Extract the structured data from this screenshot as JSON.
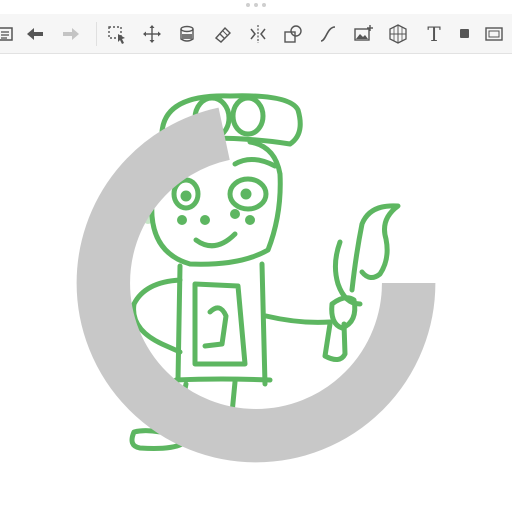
{
  "toolbar": {
    "tools": [
      {
        "id": "layers",
        "icon": "layers-list-icon"
      },
      {
        "id": "undo",
        "icon": "undo-arrow-icon"
      },
      {
        "id": "redo",
        "icon": "redo-arrow-icon"
      },
      {
        "id": "select",
        "icon": "selection-cursor-icon"
      },
      {
        "id": "move",
        "icon": "move-arrows-icon"
      },
      {
        "id": "fill",
        "icon": "paint-bucket-icon"
      },
      {
        "id": "eraser",
        "icon": "eraser-icon"
      },
      {
        "id": "symmetry",
        "icon": "symmetry-icon"
      },
      {
        "id": "shapes",
        "icon": "shapes-icon"
      },
      {
        "id": "curve",
        "icon": "curve-icon"
      },
      {
        "id": "image",
        "icon": "add-image-icon"
      },
      {
        "id": "perspective",
        "icon": "perspective-grid-icon"
      },
      {
        "id": "text",
        "icon": "text-tool-icon",
        "label": "T"
      },
      {
        "id": "color",
        "icon": "color-swatch-icon"
      },
      {
        "id": "canvas",
        "icon": "canvas-frame-icon"
      }
    ]
  },
  "canvas": {
    "stroke_color": "#4caf50",
    "drawing": "green-robot-character-sketch"
  },
  "colors": {
    "toolbar_bg": "#f6f6f6",
    "icon": "#555555",
    "ink": "#4caf50"
  }
}
